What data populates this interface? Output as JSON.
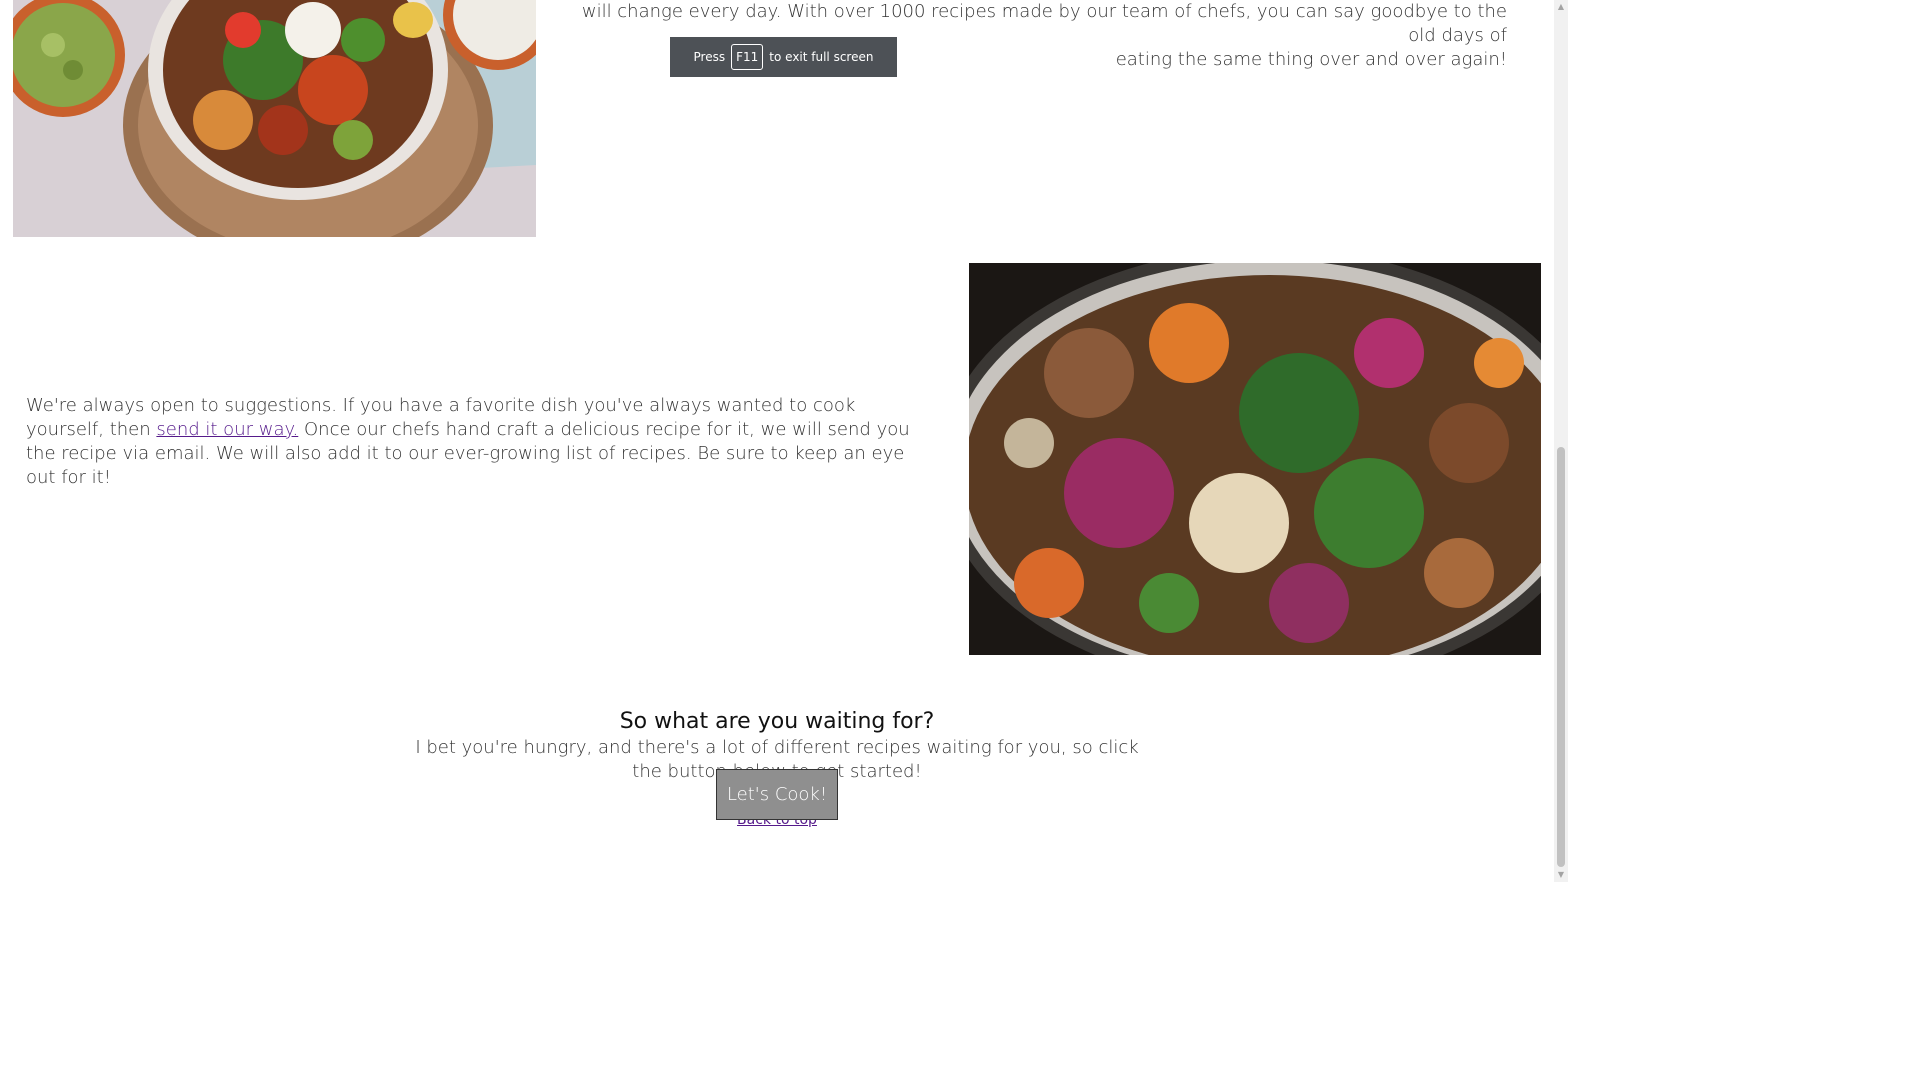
{
  "intro": {
    "line1": "will change every day. With over 1000 recipes made by our team of chefs, you can say goodbye to the old days of",
    "line2": "eating the same thing over and over again!"
  },
  "fullscreen_toast": {
    "prefix": "Press",
    "key": "F11",
    "suffix": "to exit full screen"
  },
  "suggestions": {
    "text_before": "We're always open to suggestions. If you have a favorite dish you've always wanted to cook yourself, then ",
    "link": "send it our way.",
    "text_after": " Once our chefs hand craft a delicious recipe for it, we will send you the recipe via email. We will also add it to our ever-growing list of recipes. Be sure to keep an eye out for it!"
  },
  "cta": {
    "title": "So what are you waiting for?",
    "text": "I bet you're hungry, and there's a lot of different recipes waiting for you, so click the button below to get started!",
    "button": "Let's Cook!",
    "back_to_top": "Back to top"
  },
  "images": {
    "top": "salad-bowl-photo",
    "pan": "stir-fry-pan-photo"
  },
  "colors": {
    "visited_link": "#551a8b",
    "button_bg": "#8f8f8f",
    "toast_bg": "#4d5156"
  }
}
